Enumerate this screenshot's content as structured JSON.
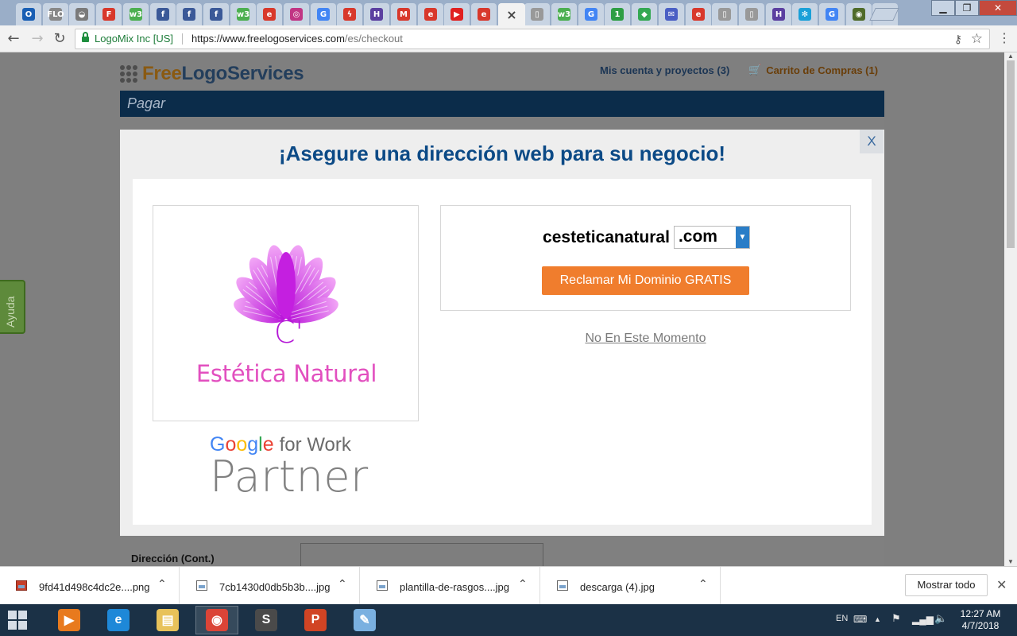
{
  "browser": {
    "tabs": [
      {
        "icon": "outlook-icon",
        "color": "#1a5fb4",
        "glyph": "O"
      },
      {
        "icon": "flo-icon",
        "color": "#888888",
        "glyph": "FLO"
      },
      {
        "icon": "bowl-icon",
        "color": "#7a7a7a",
        "glyph": "◒"
      },
      {
        "icon": "f-red-icon",
        "color": "#d8382b",
        "glyph": "F"
      },
      {
        "icon": "w3-icon",
        "color": "#4caf50",
        "glyph": "w3"
      },
      {
        "icon": "facebook-icon",
        "color": "#3b5998",
        "glyph": "f"
      },
      {
        "icon": "facebook-icon",
        "color": "#3b5998",
        "glyph": "f"
      },
      {
        "icon": "facebook-icon",
        "color": "#3b5998",
        "glyph": "f"
      },
      {
        "icon": "w3-icon",
        "color": "#4caf50",
        "glyph": "w3"
      },
      {
        "icon": "swirl-icon",
        "color": "#d8382b",
        "glyph": "e"
      },
      {
        "icon": "instagram-icon",
        "color": "#c13584",
        "glyph": "◎"
      },
      {
        "icon": "google-icon",
        "color": "#4285f4",
        "glyph": "G"
      },
      {
        "icon": "flash-icon",
        "color": "#d8382b",
        "glyph": "ϟ"
      },
      {
        "icon": "h-icon",
        "color": "#5b3fa0",
        "glyph": "H"
      },
      {
        "icon": "gmail-icon",
        "color": "#d8382b",
        "glyph": "M"
      },
      {
        "icon": "swirl-icon",
        "color": "#d8382b",
        "glyph": "e"
      },
      {
        "icon": "youtube-icon",
        "color": "#e02020",
        "glyph": "▶"
      },
      {
        "icon": "swirl-icon",
        "color": "#d8382b",
        "glyph": "e"
      },
      {
        "icon": "close-icon",
        "color": "#444444",
        "glyph": "×",
        "active": true
      },
      {
        "icon": "page-icon",
        "color": "#999999",
        "glyph": "▯"
      },
      {
        "icon": "w3-icon",
        "color": "#4caf50",
        "glyph": "w3"
      },
      {
        "icon": "google-icon",
        "color": "#4285f4",
        "glyph": "G"
      },
      {
        "icon": "one-icon",
        "color": "#2e9e44",
        "glyph": "1"
      },
      {
        "icon": "maps-icon",
        "color": "#34a853",
        "glyph": "◆"
      },
      {
        "icon": "mail-icon",
        "color": "#4a5fc4",
        "glyph": "✉"
      },
      {
        "icon": "swirl-icon",
        "color": "#d8382b",
        "glyph": "e"
      },
      {
        "icon": "page-icon",
        "color": "#999999",
        "glyph": "▯"
      },
      {
        "icon": "page-icon",
        "color": "#999999",
        "glyph": "▯"
      },
      {
        "icon": "h-icon",
        "color": "#5b3fa0",
        "glyph": "H"
      },
      {
        "icon": "snowflake-icon",
        "color": "#1aa0d8",
        "glyph": "✻"
      },
      {
        "icon": "google-icon",
        "color": "#4285f4",
        "glyph": "G"
      },
      {
        "icon": "globe-icon",
        "color": "#4f6b2a",
        "glyph": "◉"
      },
      {
        "icon": "globe-icon",
        "color": "#4f6b2a",
        "glyph": "◉"
      }
    ],
    "site_identity": "LogoMix Inc [US]",
    "url_scheme_host": "https://www.freelogoservices.com",
    "url_path": "/es/checkout"
  },
  "header": {
    "logo_free": "Free",
    "logo_rest": "LogoServices",
    "account_link": "Mis cuenta y proyectos (3)",
    "cart_link": "Carrito de Compras (1)"
  },
  "page": {
    "bar_title": "Pagar",
    "field_label": "Dirección (Cont.)",
    "help_tab": "Ayuda"
  },
  "modal": {
    "close_label": "X",
    "title": "¡Asegure una dirección web para su negocio!",
    "logo_preview": {
      "initial": "C'",
      "brand_name": "Estética Natural",
      "petal_color": "#c41fe0"
    },
    "badge": {
      "google": [
        "G",
        "o",
        "o",
        "g",
        "l",
        "e"
      ],
      "google_colors": [
        "#4285f4",
        "#ea4335",
        "#fbbc05",
        "#4285f4",
        "#34a853",
        "#ea4335"
      ],
      "for_work": "for Work",
      "partner": "Partner"
    },
    "domain_name": "cesteticanatural",
    "tld_selected": ".com",
    "claim_button": "Reclamar Mi Dominio GRATIS",
    "not_now_link": "No En Este Momento"
  },
  "downloads": {
    "items": [
      {
        "name": "9fd41d498c4dc2e....png"
      },
      {
        "name": "7cb1430d0db5b3b....jpg"
      },
      {
        "name": "plantilla-de-rasgos....jpg"
      },
      {
        "name": "descarga (4).jpg"
      }
    ],
    "show_all": "Mostrar todo"
  },
  "taskbar": {
    "apps": [
      {
        "icon": "media-player-icon",
        "color": "#e87a1e",
        "glyph": "▶"
      },
      {
        "icon": "internet-explorer-icon",
        "color": "#1e88d8",
        "glyph": "e"
      },
      {
        "icon": "file-explorer-icon",
        "color": "#e8c25a",
        "glyph": "▤"
      },
      {
        "icon": "chrome-icon",
        "color": "#db4437",
        "glyph": "◉",
        "active": true
      },
      {
        "icon": "sublime-icon",
        "color": "#4a4a4a",
        "glyph": "S"
      },
      {
        "icon": "powerpoint-icon",
        "color": "#d14424",
        "glyph": "P"
      },
      {
        "icon": "paint-icon",
        "color": "#7ab0e0",
        "glyph": "✎"
      }
    ],
    "language": "EN",
    "time": "12:27 AM",
    "date": "4/7/2018"
  }
}
